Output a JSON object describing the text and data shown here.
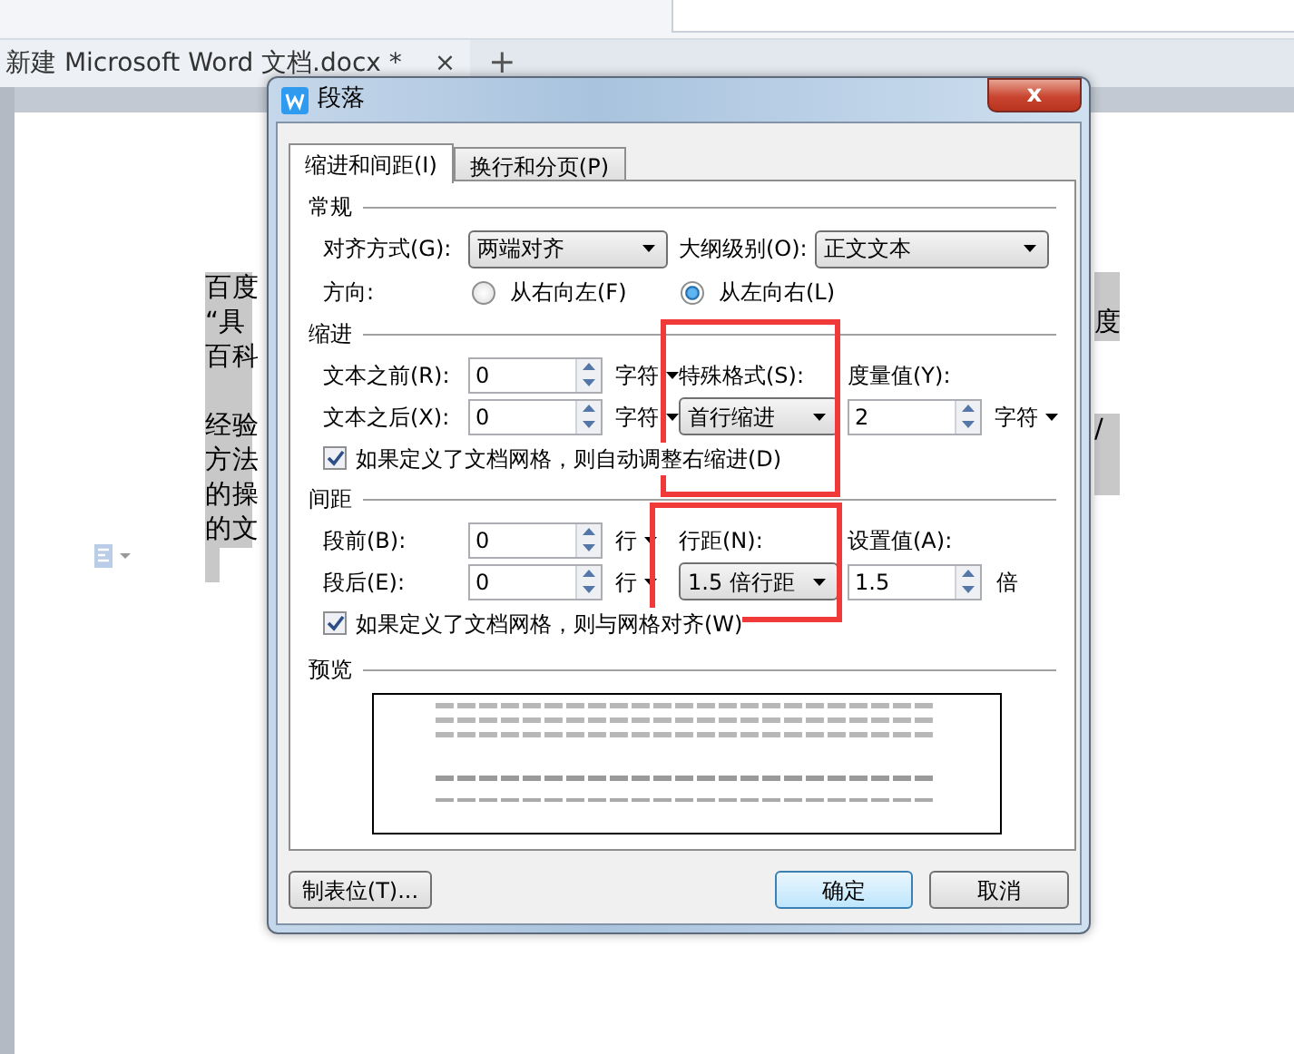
{
  "document_tab": {
    "title": "新建 Microsoft Word 文档.docx *",
    "close": "×",
    "add": "+"
  },
  "document": {
    "left_paragraphs": [
      {
        "lines": [
          "百度",
          "“具",
          "百科"
        ]
      },
      {
        "lines": [
          "经验",
          "方法",
          "的操",
          "的文"
        ]
      }
    ],
    "right_paragraphs": [
      {
        "lines": [
          "度"
        ]
      },
      {
        "lines": [
          "/"
        ]
      }
    ]
  },
  "dialog": {
    "title": "段落",
    "close": "x",
    "tabs": [
      {
        "label": "缩进和间距(I)",
        "selected": true
      },
      {
        "label": "换行和分页(P)",
        "selected": false
      }
    ],
    "general": {
      "title": "常规",
      "alignment": {
        "label": "对齐方式(G):",
        "value": "两端对齐"
      },
      "outline": {
        "label": "大纲级别(O):",
        "value": "正文文本"
      },
      "direction": {
        "label": "方向:",
        "options": [
          {
            "label": "从右向左(F)",
            "selected": false
          },
          {
            "label": "从左向右(L)",
            "selected": true
          }
        ]
      }
    },
    "indent": {
      "title": "缩进",
      "before": {
        "label": "文本之前(R):",
        "value": "0",
        "unit": "字符"
      },
      "after": {
        "label": "文本之后(X):",
        "value": "0",
        "unit": "字符"
      },
      "special": {
        "label": "特殊格式(S):",
        "value": "首行缩进"
      },
      "by": {
        "label": "度量值(Y):",
        "value": "2",
        "unit": "字符"
      },
      "grid_check": {
        "label": "如果定义了文档网格，则自动调整右缩进(D)",
        "checked": true
      }
    },
    "spacing": {
      "title": "间距",
      "before": {
        "label": "段前(B):",
        "value": "0",
        "unit": "行"
      },
      "after": {
        "label": "段后(E):",
        "value": "0",
        "unit": "行"
      },
      "line": {
        "label": "行距(N):",
        "value": "1.5 倍行距"
      },
      "at": {
        "label": "设置值(A):",
        "value": "1.5",
        "unit": "倍"
      },
      "grid_check": {
        "label": "如果定义了文档网格，则与网格对齐(W)",
        "checked": true
      }
    },
    "preview": {
      "title": "预览"
    },
    "buttons": {
      "tabs": "制表位(T)...",
      "ok": "确定",
      "cancel": "取消"
    }
  }
}
